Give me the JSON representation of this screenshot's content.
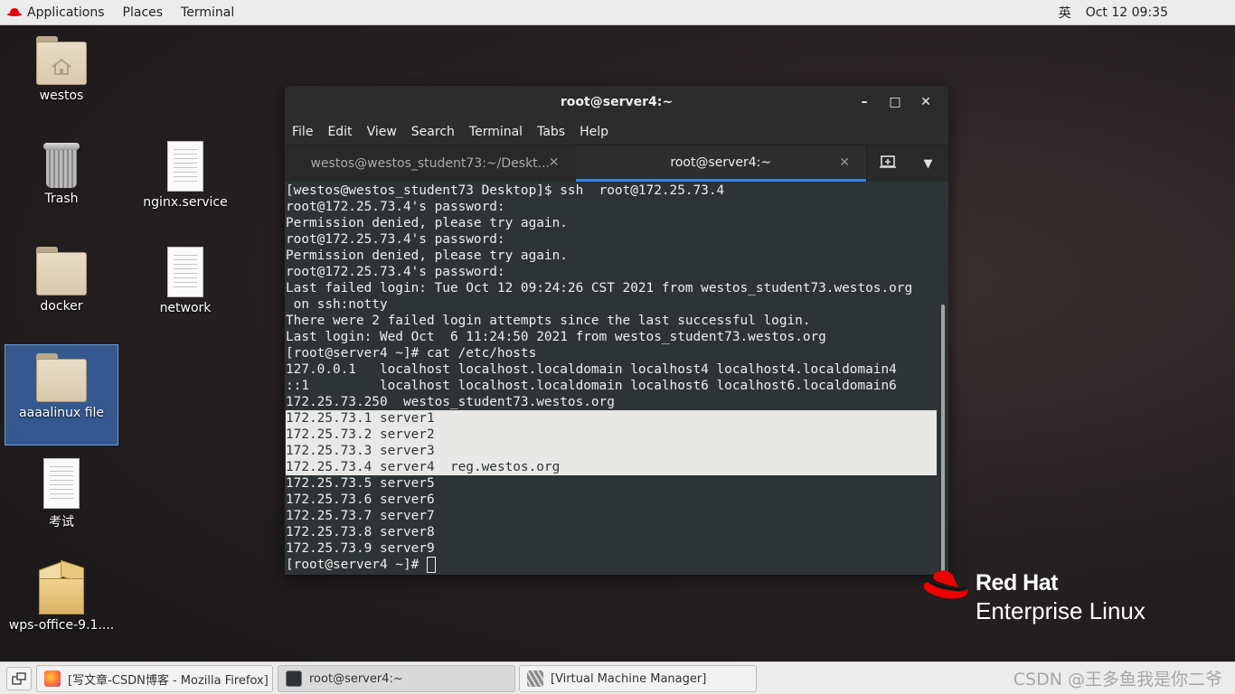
{
  "topbar": {
    "applications": "Applications",
    "places": "Places",
    "terminal": "Terminal",
    "input_method": "英",
    "clock": "Oct 12  09:35"
  },
  "desktop_icons": {
    "westos": "westos",
    "trash": "Trash",
    "nginx": "nginx.service",
    "docker": "docker",
    "network": "network",
    "aaaalinux": "aaaalinux file",
    "exam": "考试",
    "wps": "wps-office-9.1...."
  },
  "terminal": {
    "title": "root@server4:~",
    "menu": [
      "File",
      "Edit",
      "View",
      "Search",
      "Terminal",
      "Tabs",
      "Help"
    ],
    "tabs": [
      {
        "label": "westos@westos_student73:~/Deskt..."
      },
      {
        "label": "root@server4:~"
      }
    ],
    "lines": [
      "[westos@westos_student73 Desktop]$ ssh  root@172.25.73.4",
      "root@172.25.73.4's password:",
      "Permission denied, please try again.",
      "root@172.25.73.4's password:",
      "Permission denied, please try again.",
      "root@172.25.73.4's password:",
      "Last failed login: Tue Oct 12 09:24:26 CST 2021 from westos_student73.westos.org",
      " on ssh:notty",
      "There were 2 failed login attempts since the last successful login.",
      "Last login: Wed Oct  6 11:24:50 2021 from westos_student73.westos.org",
      "[root@server4 ~]# cat /etc/hosts",
      "127.0.0.1   localhost localhost.localdomain localhost4 localhost4.localdomain4",
      "::1         localhost localhost.localdomain localhost6 localhost6.localdomain6",
      "172.25.73.250  westos_student73.westos.org",
      "172.25.73.1 server1",
      "172.25.73.2 server2",
      "172.25.73.3 server3",
      "172.25.73.4 server4  reg.westos.org",
      "172.25.73.5 server5",
      "172.25.73.6 server6",
      "172.25.73.7 server7",
      "172.25.73.8 server8",
      "172.25.73.9 server9",
      "[root@server4 ~]# "
    ]
  },
  "logo": {
    "line1": "Red Hat",
    "line2": "Enterprise Linux"
  },
  "taskbar": {
    "items": [
      {
        "label": "[写文章-CSDN博客 - Mozilla Firefox]"
      },
      {
        "label": "root@server4:~"
      },
      {
        "label": "[Virtual Machine Manager]"
      }
    ],
    "watermark": "CSDN @王多鱼我是你二爷"
  },
  "colors": {
    "accent_tab": "#3584e4",
    "terminal_bg": "#2e3436",
    "selection_bg": "#e8e8e7",
    "redhat": "#ee0000"
  }
}
